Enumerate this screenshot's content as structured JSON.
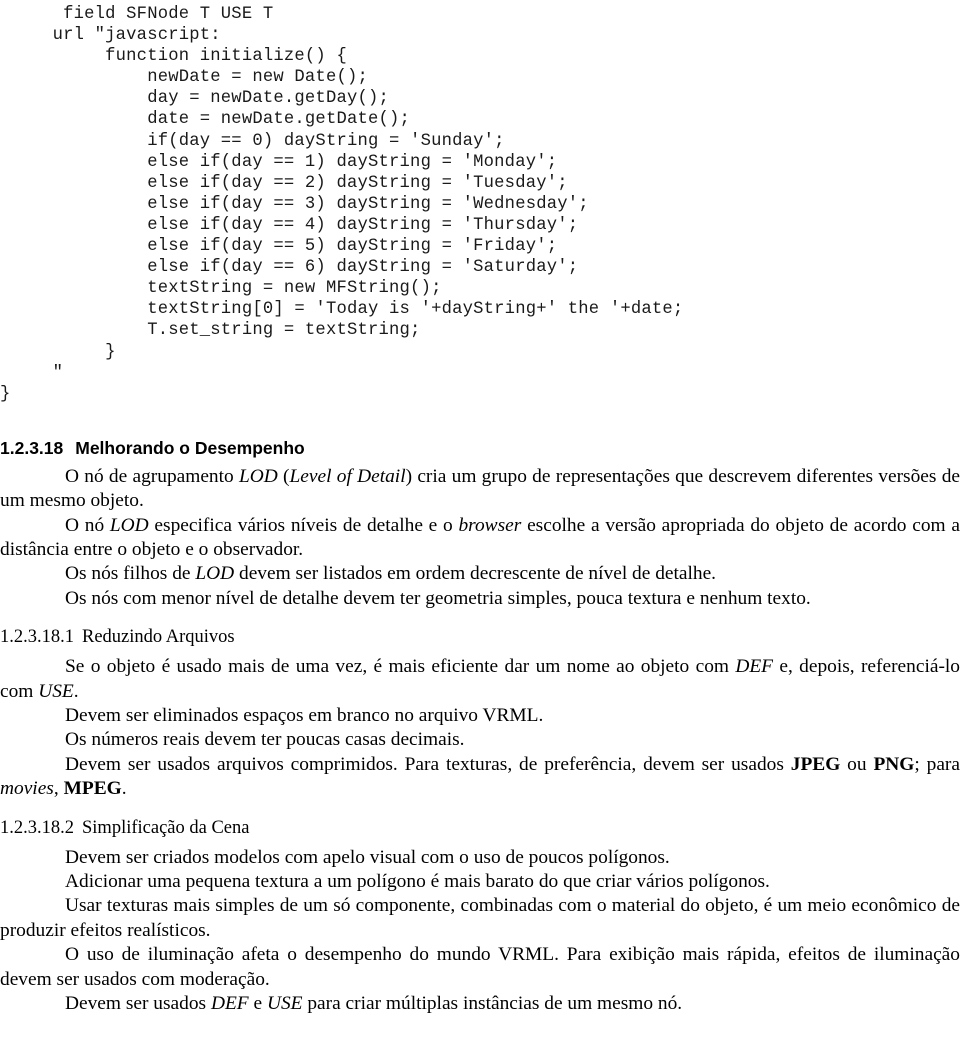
{
  "document": {
    "language": "pt-BR",
    "code_listing": {
      "name": "vrml-script-node-listing",
      "lines": [
        "      field SFNode T USE T",
        "     url \"javascript:",
        "          function initialize() {",
        "              newDate = new Date();",
        "              day = newDate.getDay();",
        "              date = newDate.getDate();",
        "              if(day == 0) dayString = 'Sunday';",
        "              else if(day == 1) dayString = 'Monday';",
        "              else if(day == 2) dayString = 'Tuesday';",
        "              else if(day == 3) dayString = 'Wednesday';",
        "              else if(day == 4) dayString = 'Thursday';",
        "              else if(day == 5) dayString = 'Friday';",
        "              else if(day == 6) dayString = 'Saturday';",
        "              textString = new MFString();",
        "              textString[0] = 'Today is '+dayString+' the '+date;",
        "              T.set_string = textString;",
        "          }",
        "     \"",
        "}"
      ]
    },
    "sections": [
      {
        "number": "1.2.3.18",
        "title": "Melhorando o Desempenho",
        "style": "sans-bold"
      },
      {
        "number": "1.2.3.18.1",
        "title": "Reduzindo Arquivos",
        "style": "serif-regular"
      },
      {
        "number": "1.2.3.18.2",
        "title": "Simplificação da Cena",
        "style": "serif-regular"
      }
    ],
    "paragraphs": {
      "p1": {
        "segments": [
          {
            "t": "O nó de agrupamento ",
            "s": "normal"
          },
          {
            "t": "LOD",
            "s": "italic"
          },
          {
            "t": " (",
            "s": "normal"
          },
          {
            "t": "Level of Detail",
            "s": "italic"
          },
          {
            "t": ") cria um grupo de representações que descrevem diferentes versões de um mesmo objeto.",
            "s": "normal"
          }
        ]
      },
      "p2": {
        "segments": [
          {
            "t": "O nó ",
            "s": "normal"
          },
          {
            "t": "LOD",
            "s": "italic"
          },
          {
            "t": " especifica vários níveis de detalhe e o ",
            "s": "normal"
          },
          {
            "t": "browser",
            "s": "italic"
          },
          {
            "t": " escolhe a versão apropriada do objeto de acordo com a distância entre o objeto e o observador.",
            "s": "normal"
          }
        ]
      },
      "p3": {
        "segments": [
          {
            "t": "Os nós filhos de ",
            "s": "normal"
          },
          {
            "t": "LOD",
            "s": "italic"
          },
          {
            "t": " devem ser listados em ordem decrescente de nível de detalhe.",
            "s": "normal"
          }
        ]
      },
      "p4": {
        "segments": [
          {
            "t": "Os nós com menor nível de detalhe devem ter geometria simples, pouca textura e nenhum texto.",
            "s": "normal"
          }
        ]
      },
      "p5": {
        "segments": [
          {
            "t": "Se o objeto é usado mais de uma vez, é mais eficiente dar um nome ao objeto com ",
            "s": "normal"
          },
          {
            "t": "DEF",
            "s": "italic"
          },
          {
            "t": " e, depois, referenciá-lo com ",
            "s": "normal"
          },
          {
            "t": "USE",
            "s": "italic"
          },
          {
            "t": ".",
            "s": "normal"
          }
        ]
      },
      "p6": {
        "segments": [
          {
            "t": "Devem ser eliminados espaços em branco no arquivo VRML.",
            "s": "normal"
          }
        ]
      },
      "p7": {
        "segments": [
          {
            "t": "Os números reais devem ter poucas casas decimais.",
            "s": "normal"
          }
        ]
      },
      "p8": {
        "segments": [
          {
            "t": "Devem ser usados arquivos comprimidos. Para texturas, de preferência, devem ser usados ",
            "s": "normal"
          },
          {
            "t": "JPEG",
            "s": "bold"
          },
          {
            "t": " ou ",
            "s": "normal"
          },
          {
            "t": "PNG",
            "s": "bold"
          },
          {
            "t": "; para ",
            "s": "normal"
          },
          {
            "t": "movies",
            "s": "italic"
          },
          {
            "t": ", ",
            "s": "normal"
          },
          {
            "t": "MPEG",
            "s": "bold"
          },
          {
            "t": ".",
            "s": "normal"
          }
        ]
      },
      "p9": {
        "segments": [
          {
            "t": "Devem ser criados modelos com apelo visual com o uso de poucos polígonos.",
            "s": "normal"
          }
        ]
      },
      "p10": {
        "segments": [
          {
            "t": "Adicionar uma pequena textura a um polígono é mais barato do que criar vários polígonos.",
            "s": "normal"
          }
        ]
      },
      "p11": {
        "segments": [
          {
            "t": "Usar texturas mais simples de um só componente, combinadas com o material do objeto, é um meio econômico de produzir efeitos realísticos.",
            "s": "normal"
          }
        ]
      },
      "p12": {
        "segments": [
          {
            "t": "O uso de iluminação afeta o desempenho do mundo VRML. Para exibição mais rápida, efeitos de iluminação devem ser usados com moderação.",
            "s": "normal"
          }
        ]
      },
      "p13": {
        "segments": [
          {
            "t": "Devem ser usados ",
            "s": "normal"
          },
          {
            "t": "DEF",
            "s": "italic"
          },
          {
            "t": " e ",
            "s": "normal"
          },
          {
            "t": "USE",
            "s": "italic"
          },
          {
            "t": " para criar múltiplas instâncias de um mesmo nó.",
            "s": "normal"
          }
        ]
      }
    }
  }
}
